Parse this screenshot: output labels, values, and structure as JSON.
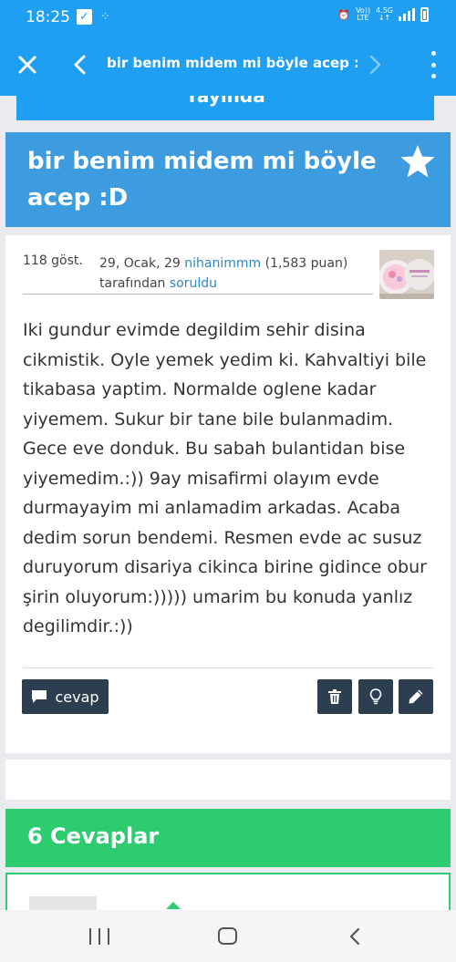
{
  "status_bar": {
    "time": "18:25",
    "volte_top": "Vo))",
    "volte_bottom": "LTE",
    "net_top": "4.5G",
    "net_bottom": "↓↑"
  },
  "app_bar": {
    "title": "bir benim midem mi böyle acep :D...",
    "icons": [
      "close-icon",
      "back-icon",
      "forward-icon",
      "more-icon"
    ]
  },
  "top_button": {
    "label": "Yayında"
  },
  "question": {
    "title": "bir benim midem mi böyle acep :D",
    "views": "118 göst.",
    "date": "29, Ocak, 29",
    "author": "nihanimmm",
    "points": "(1,583 puan)",
    "by_label": "tarafından",
    "action_link": "soruldu",
    "body": "Iki gundur evimde degildim sehir disina cikmistik. Oyle yemek yedim ki. Kahvaltiyi bile tikabasa yaptim. Normalde oglene kadar yiyemem. Sukur bir tane bile bulanmadim. Gece eve donduk. Bu sabah bulantidan bise yiyemedim.:)) 9ay misafirmi olayım evde durmayayim mi anlamadim arkadas. Acaba dedim sorun bendemi. Resmen evde ac susuz duruyorum disariya cikinca birine gidince obur şirin oluyorum:))))) umarim bu konuda yanlız degilimdir.:))",
    "answer_button": "cevap"
  },
  "answers": {
    "header": "6 Cevaplar"
  },
  "colors": {
    "primary": "#1e9ff2",
    "title_bg": "#3d9be0",
    "dark_button": "#2c3e50",
    "answers_green": "#2ecc71",
    "link": "#2a8ac8"
  }
}
